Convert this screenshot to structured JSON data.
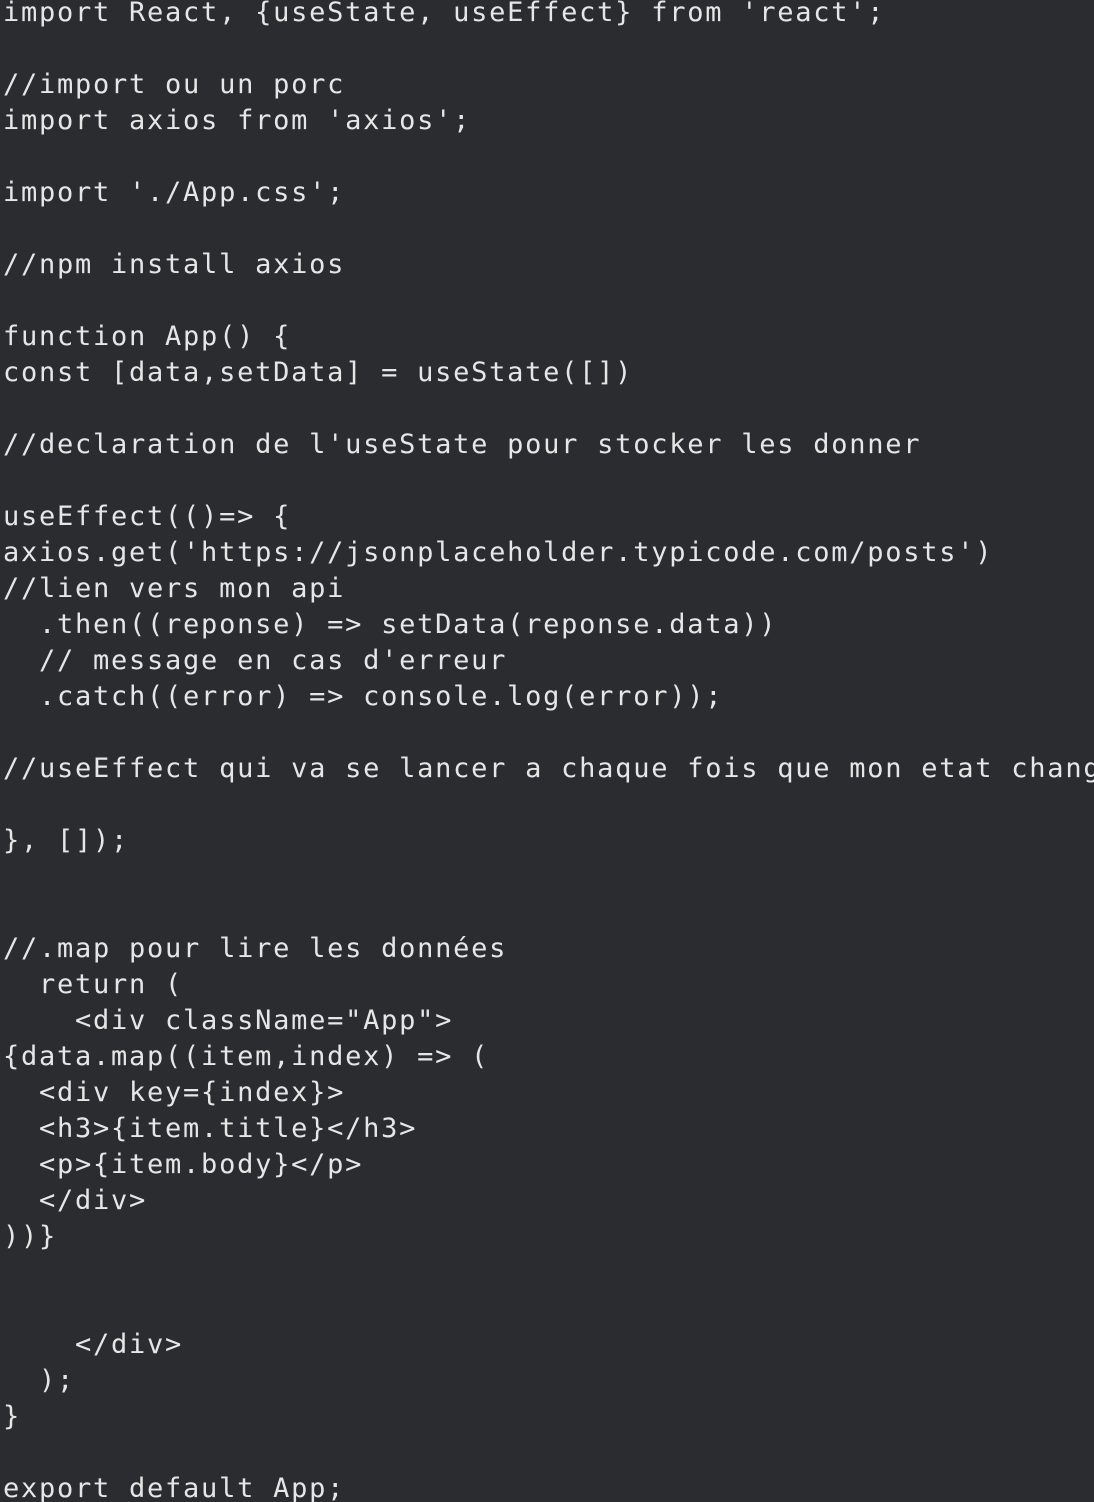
{
  "editor": {
    "lines": [
      "import React, {useState, useEffect} from 'react';",
      "",
      "//import ou un porc",
      "import axios from 'axios';",
      "",
      "import './App.css';",
      "",
      "//npm install axios",
      "",
      "function App() {",
      "const [data,setData] = useState([])",
      "",
      "//declaration de l'useState pour stocker les donner",
      "",
      "useEffect(()=> {",
      "axios.get('https://jsonplaceholder.typicode.com/posts')",
      "//lien vers mon api",
      "  .then((reponse) => setData(reponse.data))",
      "  // message en cas d'erreur",
      "  .catch((error) => console.log(error));",
      "",
      "//useEffect qui va se lancer a chaque fois que mon etat change",
      "",
      "}, []);",
      "",
      "",
      "//.map pour lire les données",
      "  return (",
      "    <div className=\"App\">",
      "{data.map((item,index) => (",
      "  <div key={index}>",
      "  <h3>{item.title}</h3>",
      "  <p>{item.body}</p>",
      "  </div>",
      "))}",
      "",
      "",
      "    </div>",
      "  );",
      "}",
      "",
      "export default App;"
    ]
  },
  "colors": {
    "background": "#2b2c30",
    "text": "#e6e6e6"
  }
}
